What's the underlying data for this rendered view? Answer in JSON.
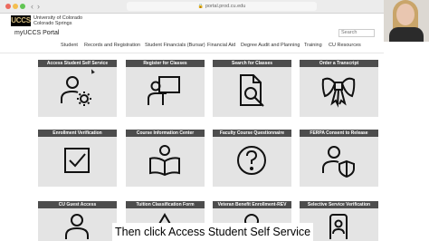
{
  "browser": {
    "url": "portal.prod.cu.edu"
  },
  "header": {
    "logo_text": "UCCS",
    "university_line1": "University of Colorado",
    "university_line2": "Colorado Springs",
    "app_title": "myUCCS Portal",
    "search_placeholder": "Search"
  },
  "nav": {
    "items": [
      "Student",
      "Records and Registration",
      "Student Financials (Bursar)",
      "Financial Aid",
      "Degree Audit and Planning",
      "Training",
      "CU Resources"
    ]
  },
  "tiles": [
    {
      "label": "Access Student Self Service",
      "icon": "user-gear-icon"
    },
    {
      "label": "Register for Classes",
      "icon": "presenter-board-icon"
    },
    {
      "label": "Search for Classes",
      "icon": "document-search-icon"
    },
    {
      "label": "Order a Transcript",
      "icon": "ribbon-diploma-icon"
    },
    {
      "label": "Enrollment Verification",
      "icon": "checkbox-icon"
    },
    {
      "label": "Course Information Center",
      "icon": "reader-book-icon"
    },
    {
      "label": "Faculty Course Questionnaire",
      "icon": "question-circle-icon"
    },
    {
      "label": "FERPA Consent to Release",
      "icon": "user-shield-icon"
    },
    {
      "label": "CU Guest Access",
      "icon": "user-icon"
    },
    {
      "label": "Tuition Classification Form",
      "icon": "warning-icon"
    },
    {
      "label": "Veteran Benefit Enrollment-REV",
      "icon": "user-icon"
    },
    {
      "label": "Selective Service Verification",
      "icon": "id-badge-icon"
    }
  ],
  "caption": "Then click Access Student Self Service",
  "colors": {
    "tile_background": "#e4e4e4",
    "tile_header": "#4d4d4d",
    "logo_gold": "#cfb87c"
  }
}
